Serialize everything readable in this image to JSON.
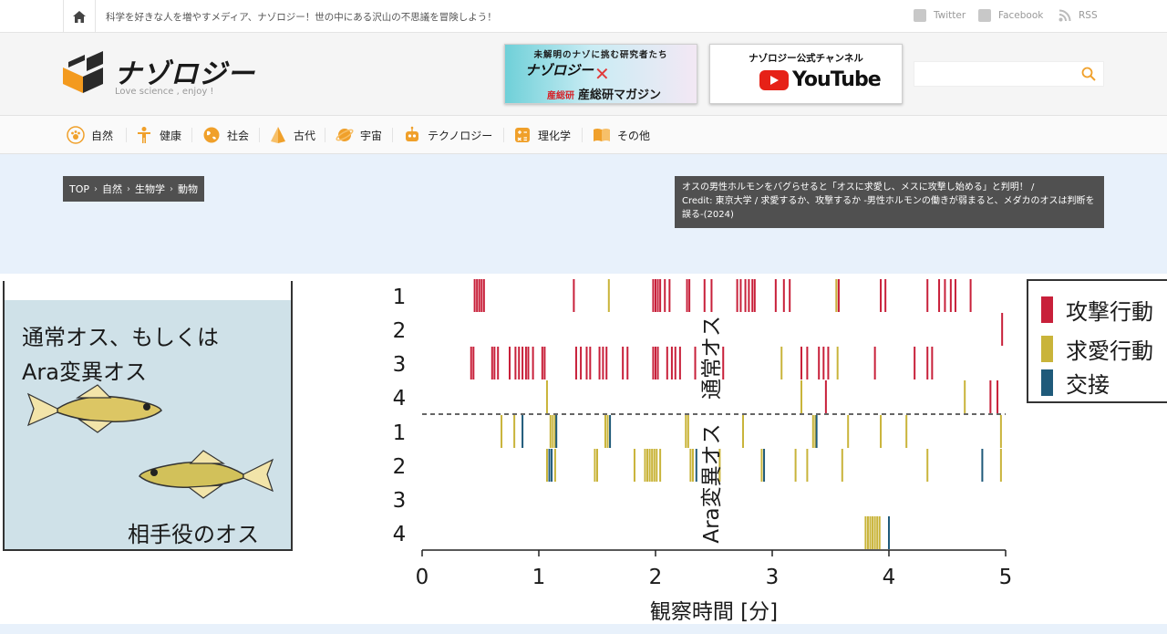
{
  "topbar": {
    "tagline": "科学を好きな人を増やすメディア、ナゾロジー！世の中にある沢山の不思議を冒険しよう！",
    "twitter": "Twitter",
    "facebook": "Facebook",
    "rss": "RSS"
  },
  "header": {
    "logo_text": "ナゾロジー",
    "logo_sub": "Love science , enjoy !",
    "banner1": {
      "top": "未解明のナゾに挑む研究者たち",
      "logo": "ナゾロジー",
      "x": "✕",
      "bottom_small": "産総研",
      "bottom": "産総研マガジン"
    },
    "banner2": {
      "top": "ナゾロジー公式チャンネル",
      "yt": "YouTube"
    },
    "search": {
      "placeholder": ""
    }
  },
  "nav": {
    "items": [
      {
        "label": "自然",
        "icon": "paw-icon"
      },
      {
        "label": "健康",
        "icon": "person-icon"
      },
      {
        "label": "社会",
        "icon": "globe-icon"
      },
      {
        "label": "古代",
        "icon": "pyramid-icon"
      },
      {
        "label": "宇宙",
        "icon": "planet-icon"
      },
      {
        "label": "テクノロジー",
        "icon": "robot-icon"
      },
      {
        "label": "理化学",
        "icon": "calculator-icon"
      },
      {
        "label": "その他",
        "icon": "book-icon"
      }
    ],
    "accent": "#f0a02a"
  },
  "breadcrumb": {
    "items": [
      "TOP",
      "自然",
      "生物学",
      "動物"
    ]
  },
  "caption": {
    "line1": "オスの男性ホルモンをバグらせると「オスに求愛し、メスに攻撃し始める」と判明！ /",
    "line2": "Credit: 東京大学 / 求愛するか、攻撃するか -男性ホルモンの働きが弱まると、メダカのオスは判断を誤る-(2024)"
  },
  "figure": {
    "tank_line1": "通常オス、もしくは",
    "tank_line2": "Ara変異オス",
    "tank_line3": "相手役のオス",
    "legend": [
      {
        "label": "攻撃行動",
        "color": "#c8203a"
      },
      {
        "label": "求愛行動",
        "color": "#c9b43a"
      },
      {
        "label": "交接",
        "color": "#1f5a7a"
      }
    ],
    "ylabel_top": "通常オス",
    "ylabel_bottom": "Ara変異オス",
    "xlabel": "観察時間 [分]",
    "row_labels": [
      "1",
      "2",
      "3",
      "4",
      "1",
      "2",
      "3",
      "4"
    ],
    "x_ticks": [
      "0",
      "1",
      "2",
      "3",
      "4",
      "5"
    ]
  },
  "chart_data": {
    "type": "scatter",
    "title": "",
    "xlabel": "観察時間 [分]",
    "ylabel": "通常オス / Ara変異オス",
    "xlim": [
      0,
      5
    ],
    "rows": [
      "通常オス 1",
      "通常オス 2",
      "通常オス 3",
      "通常オス 4",
      "Ara変異オス 1",
      "Ara変異オス 2",
      "Ara変異オス 3",
      "Ara変異オス 4"
    ],
    "series": [
      {
        "name": "攻撃行動",
        "color": "#c8203a",
        "events": [
          [
            0,
            0.45
          ],
          [
            0,
            0.47
          ],
          [
            0,
            0.49
          ],
          [
            0,
            0.51
          ],
          [
            0,
            0.53
          ],
          [
            0,
            1.3
          ],
          [
            0,
            1.98
          ],
          [
            0,
            2.0
          ],
          [
            0,
            2.02
          ],
          [
            0,
            2.04
          ],
          [
            0,
            2.08
          ],
          [
            0,
            2.12
          ],
          [
            0,
            2.27
          ],
          [
            0,
            2.29
          ],
          [
            0,
            2.42
          ],
          [
            0,
            2.48
          ],
          [
            0,
            2.7
          ],
          [
            0,
            2.73
          ],
          [
            0,
            2.77
          ],
          [
            0,
            2.8
          ],
          [
            0,
            2.83
          ],
          [
            0,
            2.85
          ],
          [
            0,
            3.03
          ],
          [
            0,
            3.1
          ],
          [
            0,
            3.15
          ],
          [
            0,
            3.55
          ],
          [
            0,
            3.57
          ],
          [
            0,
            3.93
          ],
          [
            0,
            3.97
          ],
          [
            0,
            4.33
          ],
          [
            0,
            4.43
          ],
          [
            0,
            4.48
          ],
          [
            0,
            4.53
          ],
          [
            0,
            4.57
          ],
          [
            0,
            4.7
          ],
          [
            1,
            4.97
          ],
          [
            2,
            0.42
          ],
          [
            2,
            0.44
          ],
          [
            2,
            0.6
          ],
          [
            2,
            0.62
          ],
          [
            2,
            0.65
          ],
          [
            2,
            0.75
          ],
          [
            2,
            0.8
          ],
          [
            2,
            0.83
          ],
          [
            2,
            0.86
          ],
          [
            2,
            0.89
          ],
          [
            2,
            0.91
          ],
          [
            2,
            0.95
          ],
          [
            2,
            1.03
          ],
          [
            2,
            1.05
          ],
          [
            2,
            1.32
          ],
          [
            2,
            1.36
          ],
          [
            2,
            1.41
          ],
          [
            2,
            1.44
          ],
          [
            2,
            1.52
          ],
          [
            2,
            1.55
          ],
          [
            2,
            1.58
          ],
          [
            2,
            1.72
          ],
          [
            2,
            1.76
          ],
          [
            2,
            1.98
          ],
          [
            2,
            2.0
          ],
          [
            2,
            2.02
          ],
          [
            2,
            2.1
          ],
          [
            2,
            2.14
          ],
          [
            2,
            2.17
          ],
          [
            2,
            2.21
          ],
          [
            2,
            2.34
          ],
          [
            2,
            2.58
          ],
          [
            2,
            3.25
          ],
          [
            2,
            3.3
          ],
          [
            2,
            3.4
          ],
          [
            2,
            3.44
          ],
          [
            2,
            3.48
          ],
          [
            2,
            3.88
          ],
          [
            2,
            4.22
          ],
          [
            2,
            4.33
          ],
          [
            2,
            4.37
          ],
          [
            3,
            3.46
          ],
          [
            3,
            4.87
          ],
          [
            3,
            4.93
          ]
        ]
      },
      {
        "name": "求愛行動",
        "color": "#c9b43a",
        "events": [
          [
            0,
            1.6
          ],
          [
            0,
            3.55
          ],
          [
            2,
            3.08
          ],
          [
            2,
            3.56
          ],
          [
            3,
            1.07
          ],
          [
            3,
            3.25
          ],
          [
            3,
            4.65
          ],
          [
            4,
            0.68
          ],
          [
            4,
            0.79
          ],
          [
            4,
            1.1
          ],
          [
            4,
            1.12
          ],
          [
            4,
            1.14
          ],
          [
            4,
            1.57
          ],
          [
            4,
            1.59
          ],
          [
            4,
            2.26
          ],
          [
            4,
            2.28
          ],
          [
            4,
            2.75
          ],
          [
            4,
            3.35
          ],
          [
            4,
            3.37
          ],
          [
            4,
            3.65
          ],
          [
            4,
            3.93
          ],
          [
            4,
            4.15
          ],
          [
            4,
            4.96
          ],
          [
            5,
            1.07
          ],
          [
            5,
            1.14
          ],
          [
            5,
            1.48
          ],
          [
            5,
            1.5
          ],
          [
            5,
            1.82
          ],
          [
            5,
            1.91
          ],
          [
            5,
            1.93
          ],
          [
            5,
            1.95
          ],
          [
            5,
            1.97
          ],
          [
            5,
            1.99
          ],
          [
            5,
            2.01
          ],
          [
            5,
            2.04
          ],
          [
            5,
            2.3
          ],
          [
            5,
            2.32
          ],
          [
            5,
            2.55
          ],
          [
            5,
            2.91
          ],
          [
            5,
            3.2
          ],
          [
            5,
            3.3
          ],
          [
            5,
            3.6
          ],
          [
            5,
            4.33
          ],
          [
            5,
            4.96
          ],
          [
            7,
            3.8
          ],
          [
            7,
            3.82
          ],
          [
            7,
            3.84
          ],
          [
            7,
            3.86
          ],
          [
            7,
            3.88
          ],
          [
            7,
            3.9
          ],
          [
            7,
            3.92
          ]
        ]
      },
      {
        "name": "交接",
        "color": "#1f5a7a",
        "events": [
          [
            4,
            0.86
          ],
          [
            4,
            1.15
          ],
          [
            4,
            1.61
          ],
          [
            4,
            3.38
          ],
          [
            5,
            1.09
          ],
          [
            5,
            1.11
          ],
          [
            5,
            2.35
          ],
          [
            5,
            2.93
          ],
          [
            5,
            4.8
          ],
          [
            7,
            4.0
          ]
        ]
      }
    ]
  }
}
